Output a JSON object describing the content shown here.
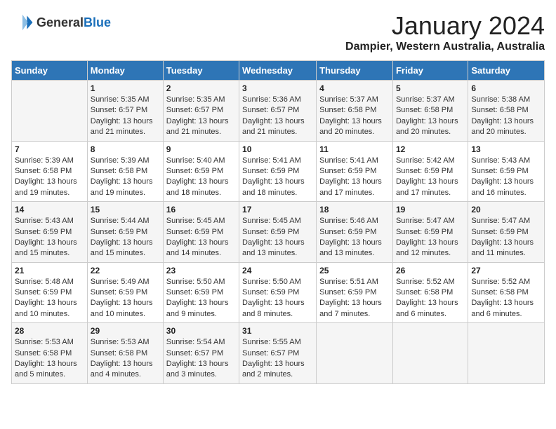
{
  "header": {
    "logo_general": "General",
    "logo_blue": "Blue",
    "month": "January 2024",
    "location": "Dampier, Western Australia, Australia"
  },
  "columns": [
    "Sunday",
    "Monday",
    "Tuesday",
    "Wednesday",
    "Thursday",
    "Friday",
    "Saturday"
  ],
  "weeks": [
    [
      {
        "day": "",
        "info": ""
      },
      {
        "day": "1",
        "info": "Sunrise: 5:35 AM\nSunset: 6:57 PM\nDaylight: 13 hours\nand 21 minutes."
      },
      {
        "day": "2",
        "info": "Sunrise: 5:35 AM\nSunset: 6:57 PM\nDaylight: 13 hours\nand 21 minutes."
      },
      {
        "day": "3",
        "info": "Sunrise: 5:36 AM\nSunset: 6:57 PM\nDaylight: 13 hours\nand 21 minutes."
      },
      {
        "day": "4",
        "info": "Sunrise: 5:37 AM\nSunset: 6:58 PM\nDaylight: 13 hours\nand 20 minutes."
      },
      {
        "day": "5",
        "info": "Sunrise: 5:37 AM\nSunset: 6:58 PM\nDaylight: 13 hours\nand 20 minutes."
      },
      {
        "day": "6",
        "info": "Sunrise: 5:38 AM\nSunset: 6:58 PM\nDaylight: 13 hours\nand 20 minutes."
      }
    ],
    [
      {
        "day": "7",
        "info": "Sunrise: 5:39 AM\nSunset: 6:58 PM\nDaylight: 13 hours\nand 19 minutes."
      },
      {
        "day": "8",
        "info": "Sunrise: 5:39 AM\nSunset: 6:58 PM\nDaylight: 13 hours\nand 19 minutes."
      },
      {
        "day": "9",
        "info": "Sunrise: 5:40 AM\nSunset: 6:59 PM\nDaylight: 13 hours\nand 18 minutes."
      },
      {
        "day": "10",
        "info": "Sunrise: 5:41 AM\nSunset: 6:59 PM\nDaylight: 13 hours\nand 18 minutes."
      },
      {
        "day": "11",
        "info": "Sunrise: 5:41 AM\nSunset: 6:59 PM\nDaylight: 13 hours\nand 17 minutes."
      },
      {
        "day": "12",
        "info": "Sunrise: 5:42 AM\nSunset: 6:59 PM\nDaylight: 13 hours\nand 17 minutes."
      },
      {
        "day": "13",
        "info": "Sunrise: 5:43 AM\nSunset: 6:59 PM\nDaylight: 13 hours\nand 16 minutes."
      }
    ],
    [
      {
        "day": "14",
        "info": "Sunrise: 5:43 AM\nSunset: 6:59 PM\nDaylight: 13 hours\nand 15 minutes."
      },
      {
        "day": "15",
        "info": "Sunrise: 5:44 AM\nSunset: 6:59 PM\nDaylight: 13 hours\nand 15 minutes."
      },
      {
        "day": "16",
        "info": "Sunrise: 5:45 AM\nSunset: 6:59 PM\nDaylight: 13 hours\nand 14 minutes."
      },
      {
        "day": "17",
        "info": "Sunrise: 5:45 AM\nSunset: 6:59 PM\nDaylight: 13 hours\nand 13 minutes."
      },
      {
        "day": "18",
        "info": "Sunrise: 5:46 AM\nSunset: 6:59 PM\nDaylight: 13 hours\nand 13 minutes."
      },
      {
        "day": "19",
        "info": "Sunrise: 5:47 AM\nSunset: 6:59 PM\nDaylight: 13 hours\nand 12 minutes."
      },
      {
        "day": "20",
        "info": "Sunrise: 5:47 AM\nSunset: 6:59 PM\nDaylight: 13 hours\nand 11 minutes."
      }
    ],
    [
      {
        "day": "21",
        "info": "Sunrise: 5:48 AM\nSunset: 6:59 PM\nDaylight: 13 hours\nand 10 minutes."
      },
      {
        "day": "22",
        "info": "Sunrise: 5:49 AM\nSunset: 6:59 PM\nDaylight: 13 hours\nand 10 minutes."
      },
      {
        "day": "23",
        "info": "Sunrise: 5:50 AM\nSunset: 6:59 PM\nDaylight: 13 hours\nand 9 minutes."
      },
      {
        "day": "24",
        "info": "Sunrise: 5:50 AM\nSunset: 6:59 PM\nDaylight: 13 hours\nand 8 minutes."
      },
      {
        "day": "25",
        "info": "Sunrise: 5:51 AM\nSunset: 6:59 PM\nDaylight: 13 hours\nand 7 minutes."
      },
      {
        "day": "26",
        "info": "Sunrise: 5:52 AM\nSunset: 6:58 PM\nDaylight: 13 hours\nand 6 minutes."
      },
      {
        "day": "27",
        "info": "Sunrise: 5:52 AM\nSunset: 6:58 PM\nDaylight: 13 hours\nand 6 minutes."
      }
    ],
    [
      {
        "day": "28",
        "info": "Sunrise: 5:53 AM\nSunset: 6:58 PM\nDaylight: 13 hours\nand 5 minutes."
      },
      {
        "day": "29",
        "info": "Sunrise: 5:53 AM\nSunset: 6:58 PM\nDaylight: 13 hours\nand 4 minutes."
      },
      {
        "day": "30",
        "info": "Sunrise: 5:54 AM\nSunset: 6:57 PM\nDaylight: 13 hours\nand 3 minutes."
      },
      {
        "day": "31",
        "info": "Sunrise: 5:55 AM\nSunset: 6:57 PM\nDaylight: 13 hours\nand 2 minutes."
      },
      {
        "day": "",
        "info": ""
      },
      {
        "day": "",
        "info": ""
      },
      {
        "day": "",
        "info": ""
      }
    ]
  ]
}
